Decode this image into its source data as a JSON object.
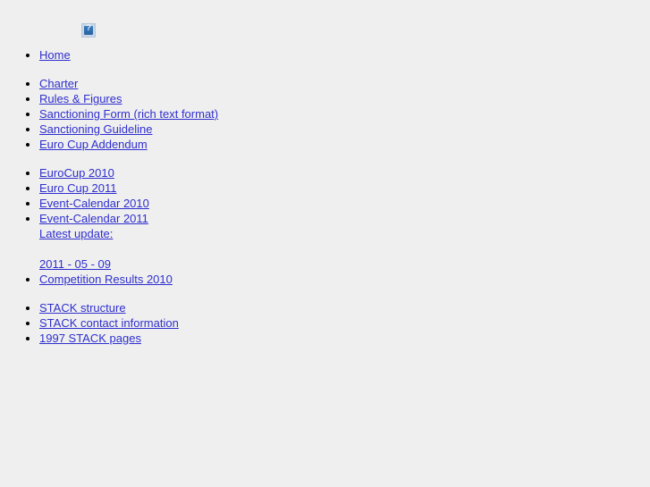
{
  "page": {
    "background_color": "#efefef",
    "link_color": "#2f2fcf",
    "text_color": "#000000"
  },
  "header": {
    "broken_image": {
      "icon": "broken-image-icon",
      "glyph": "?",
      "alt": ""
    }
  },
  "link_groups": [
    {
      "id": "group-home",
      "items": [
        {
          "label": "Home",
          "bulleted": true
        }
      ]
    },
    {
      "id": "group-documents",
      "items": [
        {
          "label": "Charter",
          "bulleted": true
        },
        {
          "label": "Rules & Figures",
          "bulleted": true
        },
        {
          "label": "Sanctioning Form (rich text format)",
          "bulleted": true
        },
        {
          "label": "Sanctioning Guideline",
          "bulleted": true
        },
        {
          "label": "Euro Cup Addendum",
          "bulleted": true
        }
      ]
    },
    {
      "id": "group-events",
      "items": [
        {
          "label": "EuroCup 2010",
          "bulleted": true
        },
        {
          "label": "Euro Cup 2011",
          "bulleted": true
        },
        {
          "label": "Event-Calendar 2010",
          "bulleted": true
        },
        {
          "label": "Event-Calendar 2011",
          "bulleted": true,
          "sub_lines": [
            "Latest update: ",
            "2011 - 05 - 09"
          ]
        },
        {
          "label": "Competition Results 2010",
          "bulleted": true
        }
      ]
    },
    {
      "id": "group-stack",
      "items": [
        {
          "label": "STACK structure",
          "bulleted": true
        },
        {
          "label": "STACK contact information",
          "bulleted": true
        },
        {
          "label": "1997 STACK pages",
          "bulleted": true
        }
      ]
    }
  ]
}
